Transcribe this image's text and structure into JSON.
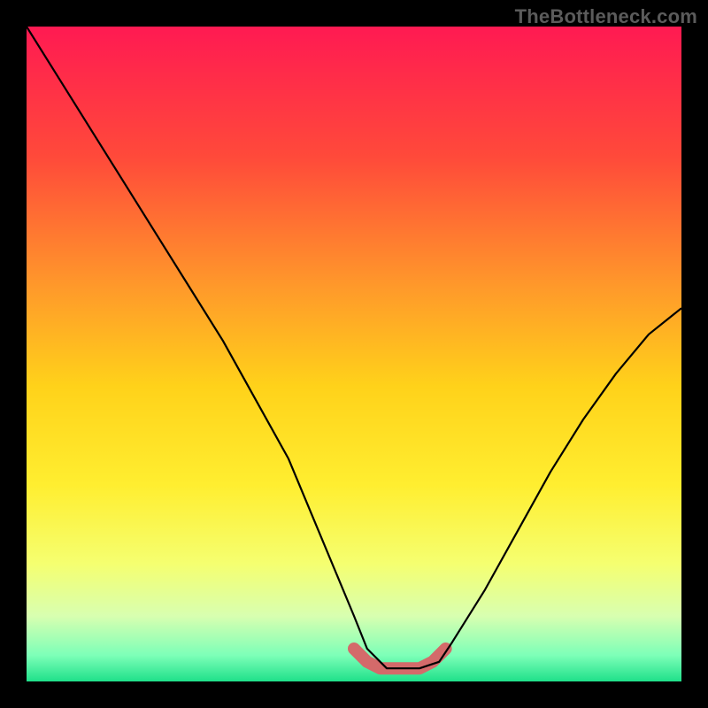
{
  "watermark": "TheBottleneck.com",
  "chart_data": {
    "type": "line",
    "title": "",
    "xlabel": "",
    "ylabel": "",
    "xlim": [
      0,
      100
    ],
    "ylim": [
      0,
      100
    ],
    "gradient_stops": [
      {
        "offset": 0,
        "color": "#ff1a52"
      },
      {
        "offset": 20,
        "color": "#ff4a3a"
      },
      {
        "offset": 40,
        "color": "#ff9a2a"
      },
      {
        "offset": 55,
        "color": "#ffd21a"
      },
      {
        "offset": 70,
        "color": "#ffee30"
      },
      {
        "offset": 82,
        "color": "#f5ff70"
      },
      {
        "offset": 90,
        "color": "#d8ffb0"
      },
      {
        "offset": 96,
        "color": "#7dffb8"
      },
      {
        "offset": 100,
        "color": "#1fe08a"
      }
    ],
    "series": [
      {
        "name": "bottleneck-curve",
        "x": [
          0,
          5,
          10,
          15,
          20,
          25,
          30,
          35,
          40,
          45,
          50,
          52,
          55,
          60,
          63,
          65,
          70,
          75,
          80,
          85,
          90,
          95,
          100
        ],
        "values": [
          100,
          92,
          84,
          76,
          68,
          60,
          52,
          43,
          34,
          22,
          10,
          5,
          2,
          2,
          3,
          6,
          14,
          23,
          32,
          40,
          47,
          53,
          57
        ]
      },
      {
        "name": "highlight-band",
        "x": [
          50,
          52,
          54,
          56,
          58,
          60,
          62,
          64
        ],
        "values": [
          5,
          3,
          2,
          2,
          2,
          2,
          3,
          5
        ]
      }
    ]
  }
}
